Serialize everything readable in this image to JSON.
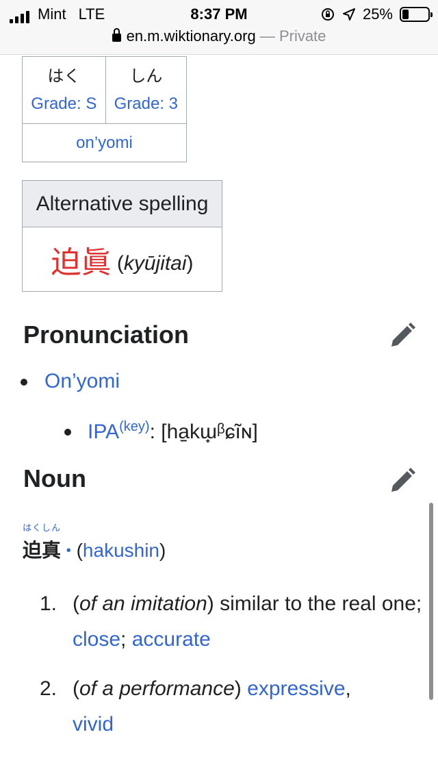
{
  "status_bar": {
    "carrier": "Mint",
    "network": "LTE",
    "time": "8:37 PM",
    "battery_percent": "25%",
    "battery_level": 0.25,
    "url": "en.m.wiktionary.org",
    "separator": "—",
    "mode": "Private"
  },
  "readings": {
    "kana": [
      "はく",
      "しん"
    ],
    "grades": [
      "Grade: S",
      "Grade: 3"
    ],
    "type": "on’yomi"
  },
  "alternative": {
    "header": "Alternative spelling",
    "kanji": "迫眞",
    "open_paren": "(",
    "note": "kyūjitai",
    "close_paren": ")"
  },
  "pronunciation": {
    "heading": "Pronunciation",
    "item": "On’yomi",
    "ipa_label": "IPA",
    "ipa_key": "(key)",
    "ipa_colon": ":",
    "ipa_value": "[ha̠kɯ̟ᵝɕĩɴ]"
  },
  "noun": {
    "heading": "Noun",
    "ruby": "はくしん",
    "headword": "迫真",
    "dot": "•",
    "romaji_open": "(",
    "romaji": "hakushin",
    "romaji_close": ")",
    "definitions": [
      {
        "num": "1.",
        "open": "(",
        "qualifier": "of an imitation",
        "close": ")",
        "text": " similar to the real one; ",
        "link1": "close",
        "sep": "; ",
        "link2": "accurate"
      },
      {
        "num": "2.",
        "open": "(",
        "qualifier": "of a performance",
        "close": ")",
        "space": " ",
        "link1": "expressive",
        "sep": ",",
        "link2": "vivid"
      }
    ]
  }
}
